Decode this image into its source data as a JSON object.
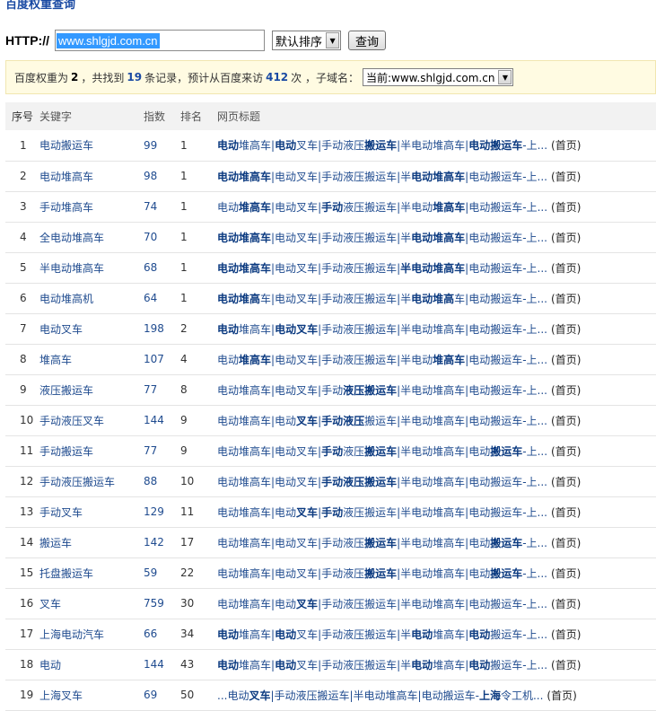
{
  "title": "百度权重查询",
  "search": {
    "http_label": "HTTP://",
    "url_value": "www.shlgjd.com.cn",
    "sort_select": "默认排序",
    "query_button": "查询"
  },
  "info": {
    "t1": "百度权重为",
    "weight": "2",
    "t2": "，共找到",
    "records": "19",
    "t3": "条记录，预计从百度来访",
    "visits": "412",
    "t4": "次 ，子域名：",
    "subdomain_select": "当前:www.shlgjd.com.cn"
  },
  "table": {
    "headers": [
      "序号",
      "关键字",
      "指数",
      "排名",
      "网页标题"
    ],
    "home_label": "(首页)",
    "rows": [
      {
        "no": "1",
        "keyword": "电动搬运车",
        "index": "99",
        "rank": "1",
        "title": "<b>电动</b>堆高车|<b>电动</b>叉车|手动液压<b>搬运车</b>|半电动堆高车|<b>电动搬运车</b>-上..."
      },
      {
        "no": "2",
        "keyword": "电动堆高车",
        "index": "98",
        "rank": "1",
        "title": "<b>电动堆高车</b>|电动叉车|手动液压搬运车|半<b>电动堆高车</b>|电动搬运车-上..."
      },
      {
        "no": "3",
        "keyword": "手动堆高车",
        "index": "74",
        "rank": "1",
        "title": "电动<b>堆高车</b>|电动叉车|<b>手动</b>液压搬运车|半电动<b>堆高车</b>|电动搬运车-上..."
      },
      {
        "no": "4",
        "keyword": "全电动堆高车",
        "index": "70",
        "rank": "1",
        "title": "<b>电动堆高车</b>|电动叉车|手动液压搬运车|半<b>电动堆高车</b>|电动搬运车-上..."
      },
      {
        "no": "5",
        "keyword": "半电动堆高车",
        "index": "68",
        "rank": "1",
        "title": "<b>电动堆高车</b>|电动叉车|手动液压搬运车|<b>半电动堆高车</b>|电动搬运车-上..."
      },
      {
        "no": "6",
        "keyword": "电动堆高机",
        "index": "64",
        "rank": "1",
        "title": "<b>电动堆高</b>车|电动叉车|手动液压搬运车|半<b>电动堆高</b>车|电动搬运车-上..."
      },
      {
        "no": "7",
        "keyword": "电动叉车",
        "index": "198",
        "rank": "2",
        "title": "<b>电动</b>堆高车|<b>电动叉车</b>|手动液压搬运车|半电动堆高车|电动搬运车-上..."
      },
      {
        "no": "8",
        "keyword": "堆高车",
        "index": "107",
        "rank": "4",
        "title": "电动<b>堆高车</b>|电动叉车|手动液压搬运车|半电动<b>堆高车</b>|电动搬运车-上..."
      },
      {
        "no": "9",
        "keyword": "液压搬运车",
        "index": "77",
        "rank": "8",
        "title": "电动堆高车|电动叉车|手动<b>液压搬运车</b>|半电动堆高车|电动搬运车-上..."
      },
      {
        "no": "10",
        "keyword": "手动液压叉车",
        "index": "144",
        "rank": "9",
        "title": "电动堆高车|电动<b>叉车</b>|<b>手动液压</b>搬运车|半电动堆高车|电动搬运车-上..."
      },
      {
        "no": "11",
        "keyword": "手动搬运车",
        "index": "77",
        "rank": "9",
        "title": "电动堆高车|电动叉车|<b>手动</b>液压<b>搬运车</b>|半电动堆高车|电动<b>搬运车</b>-上..."
      },
      {
        "no": "12",
        "keyword": "手动液压搬运车",
        "index": "88",
        "rank": "10",
        "title": "电动堆高车|电动叉车|<b>手动液压搬运车</b>|半电动堆高车|电动搬运车-上..."
      },
      {
        "no": "13",
        "keyword": "手动叉车",
        "index": "129",
        "rank": "11",
        "title": "电动堆高车|电动<b>叉车</b>|<b>手动</b>液压搬运车|半电动堆高车|电动搬运车-上..."
      },
      {
        "no": "14",
        "keyword": "搬运车",
        "index": "142",
        "rank": "17",
        "title": "电动堆高车|电动叉车|手动液压<b>搬运车</b>|半电动堆高车|电动<b>搬运车</b>-上..."
      },
      {
        "no": "15",
        "keyword": "托盘搬运车",
        "index": "59",
        "rank": "22",
        "title": "电动堆高车|电动叉车|手动液压<b>搬运车</b>|半电动堆高车|电动<b>搬运车</b>-上..."
      },
      {
        "no": "16",
        "keyword": "叉车",
        "index": "759",
        "rank": "30",
        "title": "电动堆高车|电动<b>叉车</b>|手动液压搬运车|半电动堆高车|电动搬运车-上..."
      },
      {
        "no": "17",
        "keyword": "上海电动汽车",
        "index": "66",
        "rank": "34",
        "title": "<b>电动</b>堆高车|<b>电动</b>叉车|手动液压搬运车|半<b>电动</b>堆高车|<b>电动</b>搬运车-上..."
      },
      {
        "no": "18",
        "keyword": "电动",
        "index": "144",
        "rank": "43",
        "title": "<b>电动</b>堆高车|<b>电动</b>叉车|手动液压搬运车|半<b>电动</b>堆高车|<b>电动</b>搬运车-上..."
      },
      {
        "no": "19",
        "keyword": "上海叉车",
        "index": "69",
        "rank": "50",
        "title": "...电动<b>叉车</b>|手动液压搬运车|半电动堆高车|电动搬运车-<b>上海</b>令工机..."
      }
    ]
  }
}
